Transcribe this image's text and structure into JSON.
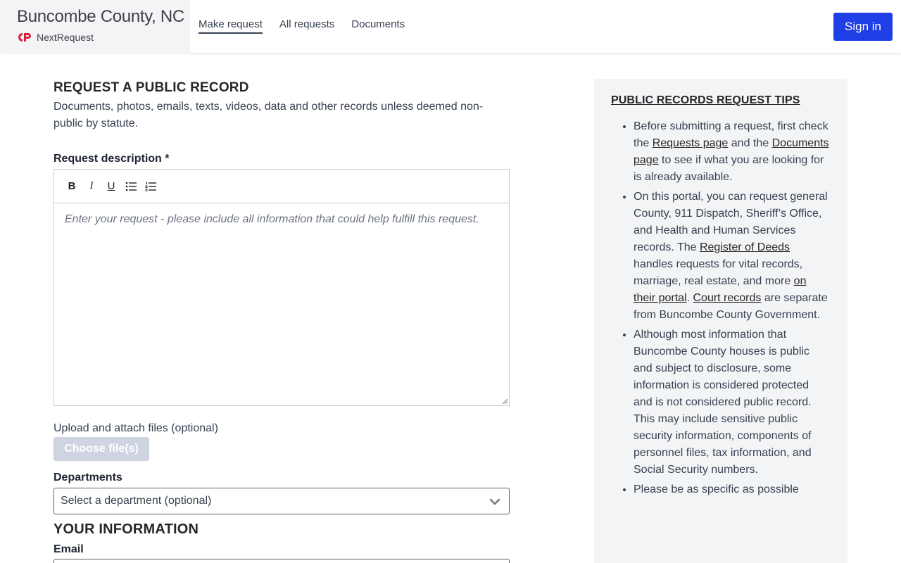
{
  "header": {
    "brand_title": "Buncombe County, NC",
    "brand_sub": "NextRequest",
    "nav": [
      "Make request",
      "All requests",
      "Documents"
    ],
    "sign_in": "Sign in",
    "accent": "#1f3fe6"
  },
  "form": {
    "title": "REQUEST A PUBLIC RECORD",
    "lede": "Documents, photos, emails, texts, videos, data and other records unless deemed non-public by statute.",
    "request_label": "Request description *",
    "toolbar": {
      "bold": "B",
      "italic": "I",
      "underline": "U"
    },
    "placeholder": "Enter your request - please include all information that could help fulfill this request.",
    "upload_label": "Upload and attach files (optional)",
    "choose_files": "Choose file(s)",
    "departments_label": "Departments",
    "department_select": "Select a department (optional)",
    "your_info": "YOUR INFORMATION",
    "email_label": "Email"
  },
  "tips": {
    "title": "PUBLIC RECORDS REQUEST TIPS",
    "t1": {
      "a": "Before submitting a request, first check the ",
      "link1": "Requests page",
      "b": " and the ",
      "link2": "Documents page",
      "c": " to see if what you are looking for is already available."
    },
    "t2": {
      "a": "On this portal, you can request general County, 911 Dispatch, Sheriff’s Office, and Health and Human Services records. The ",
      "link1": "Register of Deeds",
      "b": " handles requests for vital records, marriage, real estate, and more ",
      "link2": "on their portal",
      "c": ". ",
      "link3": "Court records",
      "d": " are separate from Buncombe County Government."
    },
    "t3": "Although most information that Buncombe County houses is public and subject to disclosure, some information is considered protected and is not considered public record. This may include sensitive public security information, components of personnel files, tax information, and Social Security numbers.",
    "t4": "Please be as specific as possible"
  }
}
